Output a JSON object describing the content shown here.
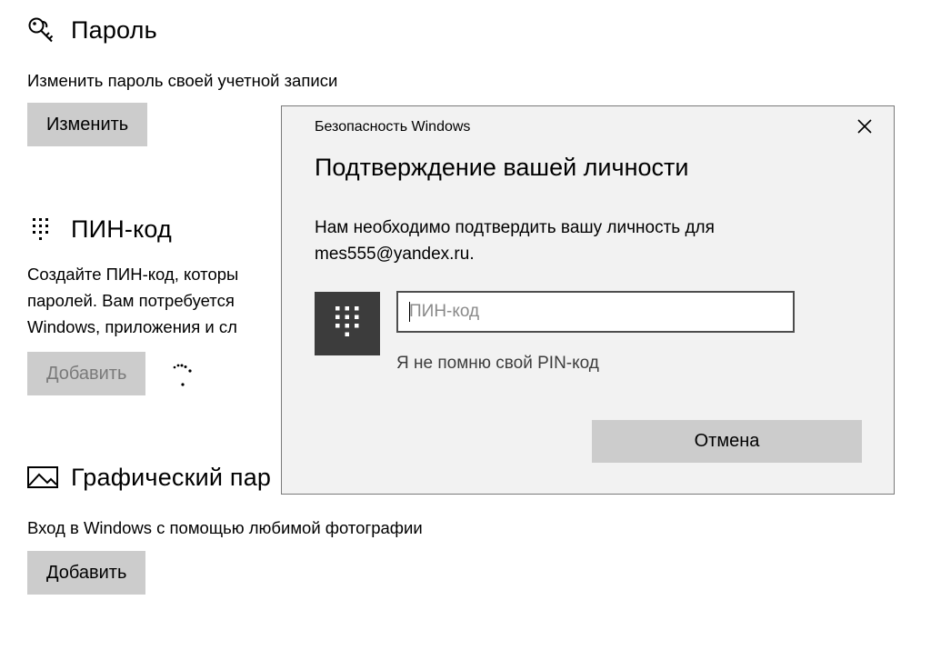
{
  "settings": {
    "password": {
      "icon": "key-icon",
      "title": "Пароль",
      "description": "Изменить пароль своей учетной записи",
      "button_label": "Изменить"
    },
    "pin": {
      "icon": "keypad-icon",
      "title": "ПИН-код",
      "description_lines": [
        "Создайте ПИН-код, которы",
        "паролей. Вам потребуется",
        "Windows, приложения и сл"
      ],
      "button_label": "Добавить"
    },
    "picture_password": {
      "icon": "picture-icon",
      "title": "Графический пар",
      "description": "Вход в Windows с помощью любимой фотографии",
      "button_label": "Добавить"
    }
  },
  "dialog": {
    "caption": "Безопасность Windows",
    "heading": "Подтверждение вашей личности",
    "message_line1": "Нам необходимо подтвердить вашу личность для",
    "message_line2": "mes555@yandex.ru.",
    "pin_placeholder": "ПИН-код",
    "pin_value": "",
    "forgot_link": "Я не помню свой PIN-код",
    "cancel_label": "Отмена",
    "close_icon": "close-icon",
    "tile_icon": "keypad-icon"
  },
  "colors": {
    "dialog_bg": "#f2f2f2",
    "button_bg": "#cccccc",
    "tile_bg": "#3c3c3c"
  }
}
